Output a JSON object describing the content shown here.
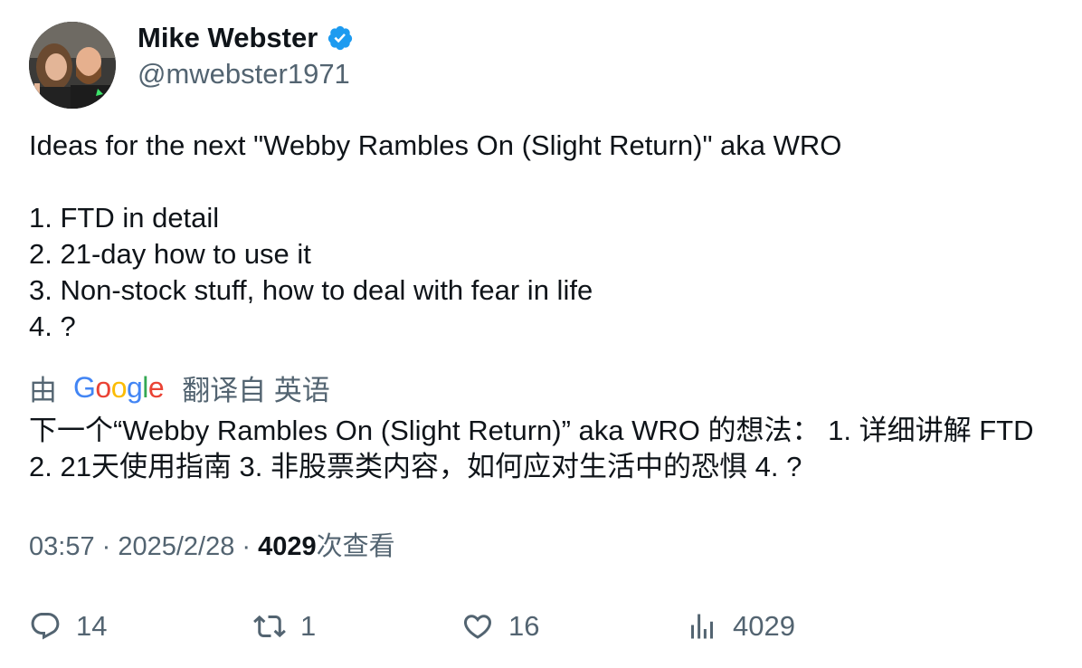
{
  "author": {
    "name": "Mike Webster",
    "handle": "@mwebster1971"
  },
  "tweet": {
    "text": "Ideas for the next \"Webby Rambles On (Slight Return)\" aka WRO\n\n1. FTD in detail\n2. 21-day how to use it\n3. Non-stock stuff, how to deal with fear in life\n4. ?"
  },
  "translation": {
    "by_label": "由",
    "google_logo": "Google",
    "from_label": "翻译自 英语",
    "text": "下一个“Webby Rambles On (Slight Return)” aka WRO 的想法： 1. 详细讲解 FTD 2. 21天使用指南 3. 非股票类内容，如何应对生活中的恐惧 4. ?"
  },
  "meta": {
    "time": "03:57",
    "separator": " · ",
    "date": "2025/2/28",
    "views_count": "4029",
    "views_label": "次查看"
  },
  "actions": {
    "replies": "14",
    "retweets": "1",
    "likes": "16",
    "views": "4029"
  },
  "colors": {
    "text": "#0f1419",
    "secondary": "#536471",
    "verified": "#1d9bf0"
  }
}
